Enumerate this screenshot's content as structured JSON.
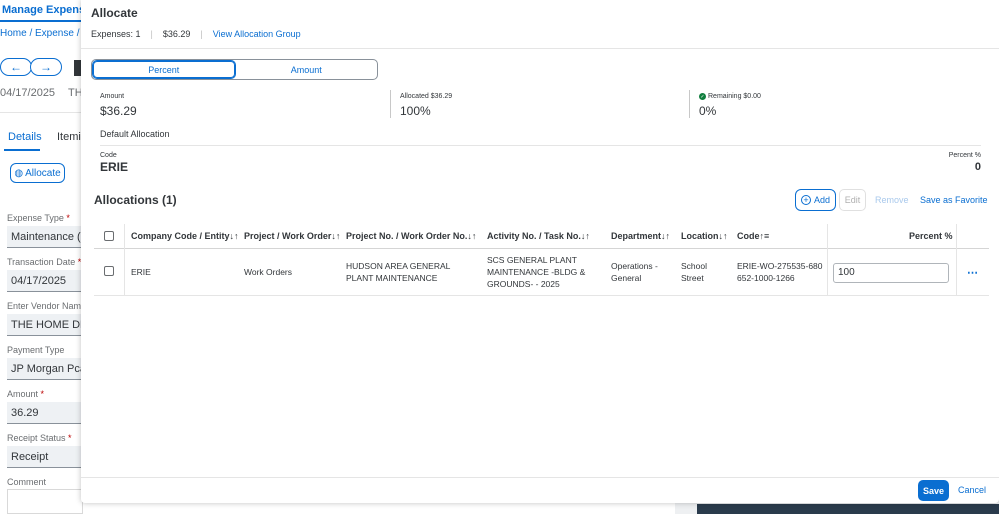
{
  "background": {
    "tab": "Manage Expenses",
    "breadcrumb": "Home / Expense / Mai",
    "date": "04/17/2025",
    "th": "TH",
    "tabs": {
      "details": "Details",
      "itemize": "Itemiz"
    },
    "allocate_button": "Allocate",
    "fields": [
      {
        "label": "Expense Type",
        "required": "*",
        "value": "Maintenance (Ma"
      },
      {
        "label": "Transaction Date",
        "required": "*",
        "value": "04/17/2025"
      },
      {
        "label": "Enter Vendor Name",
        "required": "*",
        "value": "THE HOME DEP"
      },
      {
        "label": "Payment Type",
        "required": "",
        "value": "JP Morgan Pcard"
      },
      {
        "label": "Amount",
        "required": "*",
        "value": "36.29"
      },
      {
        "label": "Receipt Status",
        "required": "*",
        "value": "Receipt"
      }
    ],
    "comment_label": "Comment"
  },
  "dialog": {
    "title": "Allocate",
    "expenses": "Expenses: 1",
    "total": "$36.29",
    "view_group_link": "View Allocation Group",
    "segments": {
      "percent": "Percent",
      "amount": "Amount"
    },
    "summary": {
      "amount_label": "Amount",
      "amount_value": "$36.29",
      "allocated_label": "Allocated $36.29",
      "allocated_value": "100%",
      "remaining_label": "Remaining $0.00",
      "remaining_value": "0%"
    },
    "default_allocation": "Default Allocation",
    "code_label": "Code",
    "code_value": "ERIE",
    "percent_label": "Percent %",
    "percent_value": "0",
    "allocations_title": "Allocations (1)",
    "toolbar": {
      "add": "Add",
      "edit": "Edit",
      "remove": "Remove",
      "favorite": "Save as Favorite"
    },
    "columns": [
      "Company Code / Entity↓↑",
      "Project / Work Order↓↑",
      "Project No. / Work Order No.↓↑",
      "Activity No. / Task No.↓↑",
      "Department↓↑",
      "Location↓↑",
      "Code↑≡",
      "Percent %"
    ],
    "rows": [
      {
        "company": "ERIE",
        "project": "Work Orders",
        "project_no": "HUDSON AREA GENERAL PLANT MAINTENANCE",
        "activity": "SCS GENERAL PLANT MAINTENANCE -BLDG & GROUNDS- - 2025",
        "department": "Operations - General",
        "location": "School Street",
        "code": "ERIE-WO-275535-680652-1000-1266",
        "percent": "100"
      }
    ],
    "footer": {
      "save": "Save",
      "cancel": "Cancel"
    }
  }
}
